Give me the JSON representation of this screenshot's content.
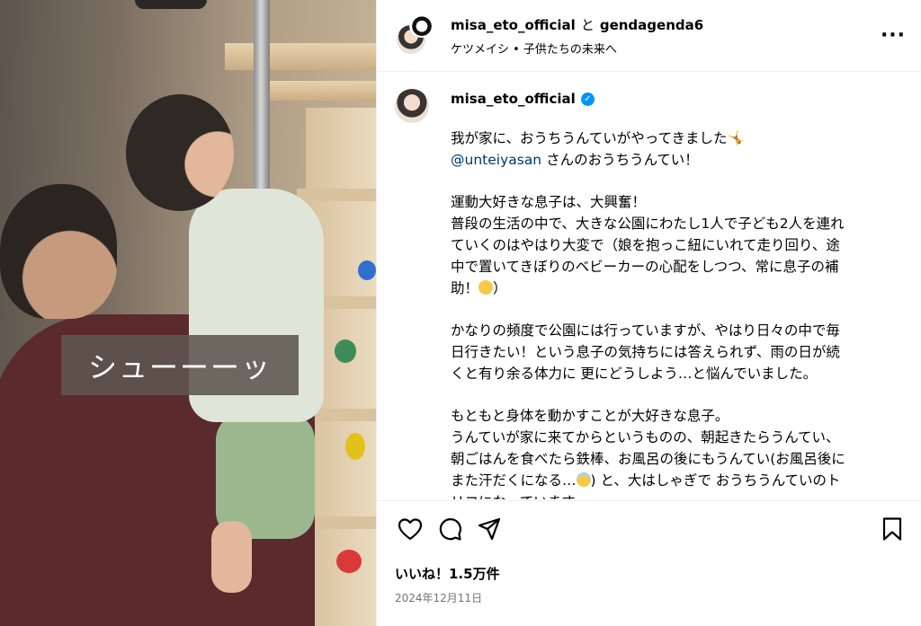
{
  "media": {
    "caption_overlay": "シューーーッ"
  },
  "header": {
    "owner": "misa_eto_official",
    "and": "と",
    "collaborator": "gendagenda6",
    "audio": "ケツメイシ • 子供たちの未来へ",
    "more": "···"
  },
  "caption": {
    "username": "misa_eto_official",
    "verified_icon": "verified-badge-icon",
    "line1": "我が家に、おうちうんていがやってきました🤸",
    "mention": "@unteiyasan",
    "line2_rest": " さんのおうちうんてい！",
    "p2": "運動大好きな息子は、大興奮！\n普段の生活の中で、大きな公園にわたし1人で子ども2人を連れ\nていくのはやはり大変で（娘を抱っこ紐にいれて走り回り、途\n中で置いてきぼりのベビーカーの心配をしつつ、常に息子の補\n助！",
    "p2_tail": "）",
    "p3": "かなりの頻度で公園には行っていますが、やはり日々の中で毎\n日行きたい！という息子の気持ちには答えられず、雨の日が続\nくと有り余る体力に 更にどうしよう…と悩んでいました。",
    "p4": "もともと身体を動かすことが大好きな息子。\nうんていが家に来てからというものの、朝起きたらうんてい、\n朝ごはんを食べたら鉄棒、お風呂の後にもうんてい(お風呂後に\nまた汗だくになる…",
    "p4_tail": ") と、大はしゃぎで おうちうんていのト\nリコになっています。"
  },
  "actions": {
    "like_icon": "heart-icon",
    "comment_icon": "comment-icon",
    "share_icon": "share-icon",
    "save_icon": "bookmark-icon",
    "likes": "いいね！1.5万件",
    "date": "2024年12月11日"
  }
}
